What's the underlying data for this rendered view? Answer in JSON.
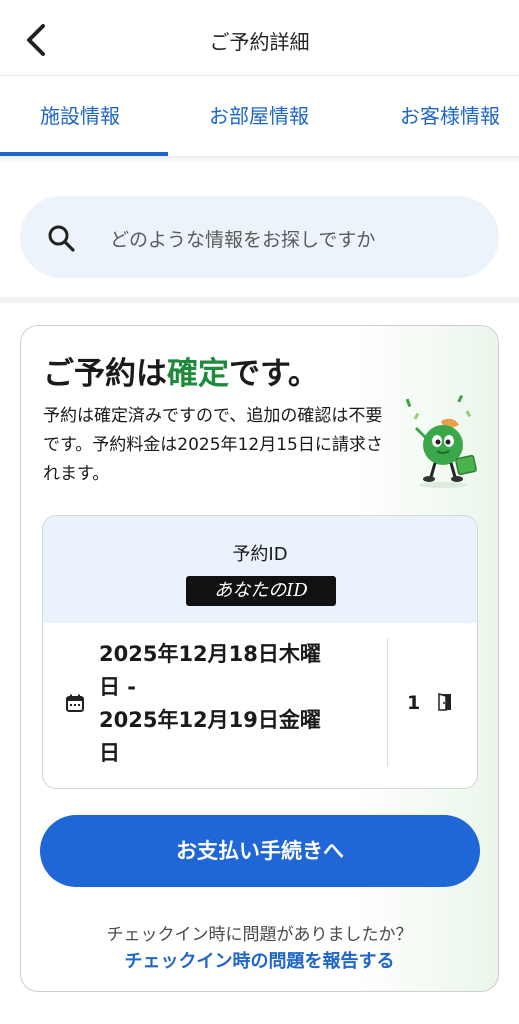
{
  "header": {
    "title": "ご予約詳細",
    "back_icon": "chevron-left-icon"
  },
  "tabs": [
    {
      "label": "施設情報",
      "active": true
    },
    {
      "label": "お部屋情報",
      "active": false
    },
    {
      "label": "お客様情報",
      "active": false
    }
  ],
  "search": {
    "placeholder": "どのような情報をお探しですか",
    "icon": "search-icon"
  },
  "confirmation": {
    "title_prefix": "ご予約は",
    "title_highlight": "確定",
    "title_suffix": "です。",
    "description": "予約は確定済みですので、追加の確認は不要です。予約料金は2025年12月15日に請求されます。"
  },
  "booking": {
    "id_label": "予約ID",
    "id_value": "あなたのID",
    "checkin_line1": "2025年12月18日木曜",
    "checkin_line2": "日 -",
    "checkout_line1": "2025年12月19日金曜",
    "checkout_line2": "日",
    "room_count": "1",
    "calendar_icon": "calendar-icon",
    "room_icon": "door-icon"
  },
  "actions": {
    "pay_label": "お支払い手続きへ",
    "issue_question": "チェックイン時に問題がありましたか？",
    "issue_link": "チェックイン時の問題を報告する"
  },
  "colors": {
    "accent_blue": "#1f66d6",
    "confirm_green": "#1e8a3c",
    "search_bg": "#edf3fb"
  }
}
